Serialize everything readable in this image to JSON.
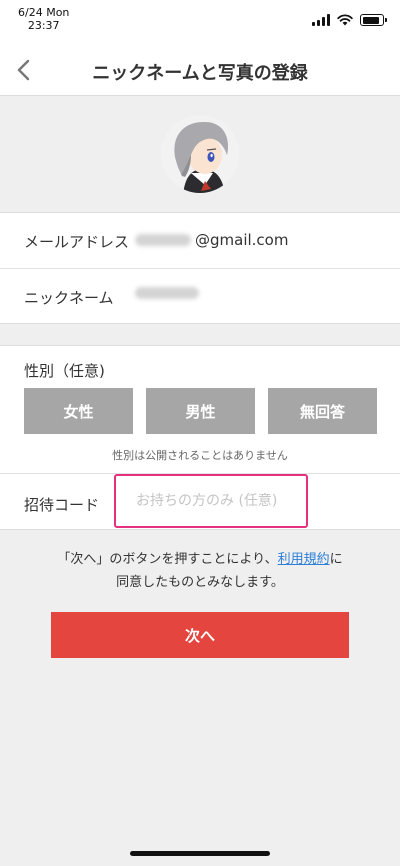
{
  "status_bar": {
    "date": "6/24 Mon",
    "time": "23:37"
  },
  "nav": {
    "title": "ニックネームと写真の登録",
    "back_icon": "chevron-left-icon"
  },
  "profile": {
    "avatar_icon": "anime-character-avatar"
  },
  "email": {
    "label": "メールアドレス",
    "domain": "@gmail.com"
  },
  "nickname": {
    "label": "ニックネーム"
  },
  "gender": {
    "title": "性別（任意)",
    "options": [
      "女性",
      "男性",
      "無回答"
    ],
    "note": "性別は公開されることはありません"
  },
  "invite": {
    "label": "招待コード",
    "placeholder": "お持ちの方のみ (任意)"
  },
  "terms": {
    "prefix": "「次へ」のボタンを押すことにより、",
    "link": "利用規約",
    "suffix": "に",
    "line2": "同意したものとみなします。"
  },
  "next_button": "次へ",
  "colors": {
    "primary": "#e5453f",
    "input_border": "#e4307f",
    "link": "#2e7fd6",
    "gender_button": "#a6a6a6"
  }
}
